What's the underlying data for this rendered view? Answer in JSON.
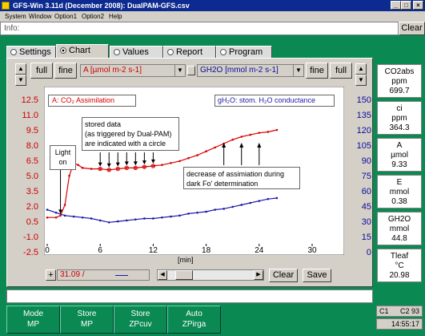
{
  "window": {
    "title": "GFS-Win 3.11d (December 2008): DualPAM-GFS.csv"
  },
  "menu": [
    "System",
    "Window",
    "Option1",
    "Option2",
    "Help"
  ],
  "info": {
    "label": "Info:",
    "clear": "Clear"
  },
  "tabs": [
    "Settings",
    "Chart",
    "Values",
    "Report",
    "Program"
  ],
  "toolbar": {
    "full_left": "full",
    "fine_left": "fine",
    "channel_left": "A [µmol m-2 s-1]",
    "channel_right": "GH2O [mmol m-2 s-1]",
    "fine_right": "fine",
    "full_right": "full"
  },
  "chart": {
    "legend_left": "A: CO₂ Assimilation",
    "legend_right": "gH₂O: stom. H₂O conductance",
    "annot_stored": "stored data\n(as triggered by Dual-PAM)\nare indicated with a circle",
    "annot_light": "Light\non",
    "annot_decrease": "decrease of assimiation during\ndark Fo' determination",
    "x_label": "[min]",
    "left_ticks": [
      "12.5",
      "11.0",
      "9.5",
      "8.0",
      "6.5",
      "5.0",
      "3.5",
      "2.0",
      "0.5",
      "-1.0",
      "-2.5"
    ],
    "right_ticks": [
      "150",
      "135",
      "120",
      "105",
      "90",
      "75",
      "60",
      "45",
      "30",
      "15",
      "0"
    ],
    "x_ticks": [
      "0",
      "6",
      "12",
      "18",
      "24",
      "30"
    ],
    "colors": {
      "assim": "#d80000",
      "cond": "#1a1aa8",
      "left_axis": "#cc0000",
      "right_axis": "#0a0a9a"
    }
  },
  "chart_data": {
    "type": "line",
    "title": "",
    "xlabel": "[min]",
    "ylabel_left": "A [µmol m-2 s-1]",
    "ylabel_right": "GH2O [mmol m-2 s-1]",
    "xlim": [
      0,
      30
    ],
    "ylim_left": [
      -2.5,
      12.5
    ],
    "ylim_right": [
      0,
      150
    ],
    "series": [
      {
        "name": "A: CO₂ Assimilation",
        "axis": "left",
        "color": "#d80000",
        "x": [
          0,
          1,
          1.5,
          2,
          2.5,
          3,
          3.5,
          4,
          5,
          6,
          7,
          8,
          9,
          10,
          11,
          12,
          13,
          14,
          15,
          16,
          17,
          18,
          19,
          20,
          21,
          22,
          23,
          24,
          25,
          26
        ],
        "y": [
          0.2,
          0.2,
          0.4,
          1.5,
          4.5,
          5.8,
          5.6,
          5.3,
          5.2,
          5.2,
          5.1,
          5.2,
          5.3,
          5.3,
          5.4,
          5.5,
          5.6,
          5.8,
          6.0,
          6.3,
          6.6,
          7.0,
          7.4,
          7.8,
          8.2,
          8.5,
          8.7,
          8.9,
          9.0,
          9.2
        ]
      },
      {
        "name": "gH₂O: stom. H₂O conductance",
        "axis": "right",
        "color": "#1a1aa8",
        "x": [
          0,
          1,
          2,
          3,
          4,
          5,
          6,
          7,
          8,
          9,
          10,
          11,
          12,
          13,
          14,
          15,
          16,
          17,
          18,
          19,
          20,
          21,
          22,
          23,
          24,
          25,
          26
        ],
        "y": [
          35,
          32,
          29,
          28,
          27,
          26,
          24,
          22,
          23,
          24,
          25,
          26,
          26,
          27,
          28,
          29,
          31,
          32,
          33,
          35,
          36,
          38,
          40,
          42,
          44,
          46,
          47
        ]
      }
    ],
    "stored_points_x": [
      6,
      7,
      8,
      9,
      10,
      11,
      12
    ],
    "grid": false
  },
  "scrollbar": {
    "value": "31.09 /",
    "clear": "Clear",
    "save": "Save"
  },
  "readouts": [
    {
      "name": "CO2abs",
      "unit": "ppm",
      "value": "699.7"
    },
    {
      "name": "ci",
      "unit": "ppm",
      "value": "364.3"
    },
    {
      "name": "A",
      "unit": "µmol",
      "value": "9.33"
    },
    {
      "name": "E",
      "unit": "mmol",
      "value": "0.38"
    },
    {
      "name": "GH2O",
      "unit": "mmol",
      "value": "44.8"
    },
    {
      "name": "Tleaf",
      "unit": "°C",
      "value": "20.98"
    }
  ],
  "bottom_buttons": [
    {
      "line1": "Mode",
      "line2": "MP"
    },
    {
      "line1": "Store",
      "line2": "MP"
    },
    {
      "line1": "Store",
      "line2": "ZPcuv"
    },
    {
      "line1": "Auto",
      "line2": "ZPirga"
    }
  ],
  "status": {
    "c1": "C1",
    "c2": "C2 93",
    "time": "14:55:17"
  }
}
